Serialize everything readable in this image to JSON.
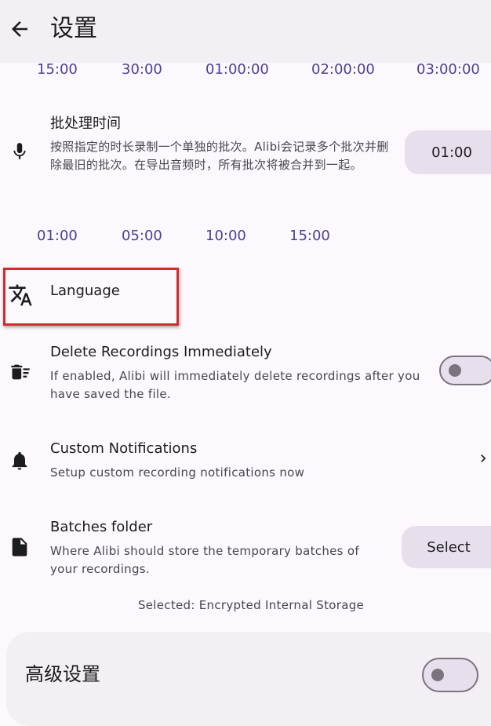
{
  "header": {
    "title": "设置",
    "back_icon": "arrow-left-icon"
  },
  "duration_chips": [
    "15:00",
    "30:00",
    "01:00:00",
    "02:00:00",
    "03:00:00"
  ],
  "batch_setting": {
    "icon": "microphone-icon",
    "title": "批处理时间",
    "description": "按照指定的时长录制一个单独的批次。Alibi会记录多个批次并删除最旧的批次。在导出音频时，所有批次将被合并到一起。",
    "value": "01:00",
    "chips": [
      "01:00",
      "05:00",
      "10:00",
      "15:00"
    ]
  },
  "language_setting": {
    "icon": "translate-icon",
    "title": "Language"
  },
  "delete_setting": {
    "icon": "delete-sweep-icon",
    "title": "Delete Recordings Immediately",
    "description": "If enabled, Alibi will immediately delete recordings after you have saved the file.",
    "enabled": false
  },
  "notifications_setting": {
    "icon": "bell-icon",
    "title": "Custom Notifications",
    "description": "Setup custom recording notifications now"
  },
  "batches_folder_setting": {
    "icon": "file-icon",
    "title": "Batches folder",
    "description": "Where Alibi should store the temporary batches of your recordings.",
    "button_label": "Select",
    "selected_text": "Selected: Encrypted Internal Storage"
  },
  "advanced": {
    "title": "高级设置",
    "enabled": false
  },
  "colors": {
    "background": "#fdf8fd",
    "surface": "#f4eff4",
    "chip_text": "#4a4191",
    "highlight": "#d32a2a"
  }
}
